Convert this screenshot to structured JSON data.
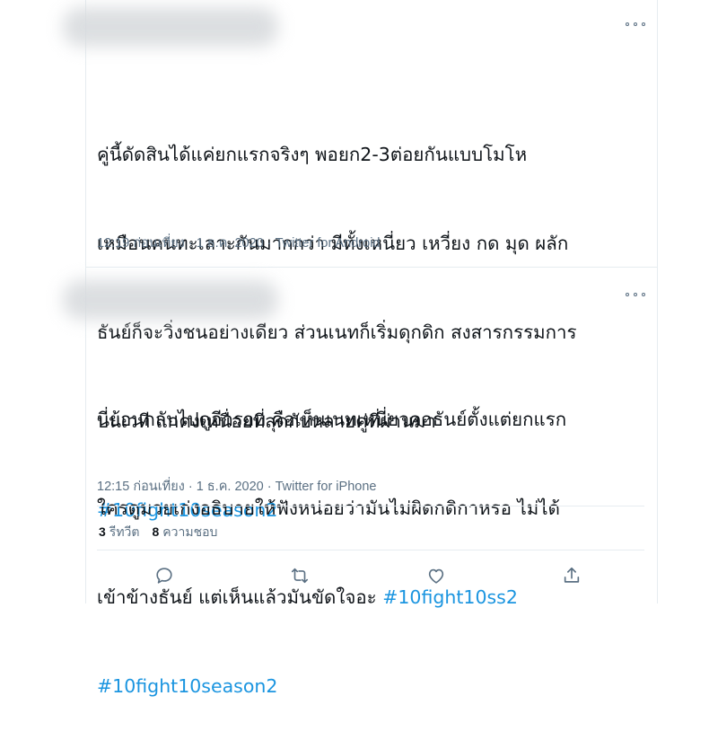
{
  "tweets": [
    {
      "text_lines": [
        "คู่นี้ดัดสินได้แค่ยกแรกจริงๆ พอยก2-3ต่อยกันแบบโมโห",
        "เหมือนคนทะเลาะกันมากกว่า มีทั้งเหนี่ยว เหวี่ยง กด มุด ผลัก",
        "ธันย์ก็จะวิ่งชนอย่างเดียว ส่วนเนทก็เริ่มดุกดิก สงสารกรรมการ",
        "บนเวที แกคงเหนื่อยที่สุดกับหลายคู่ที่ผ่านมา"
      ],
      "hashtags": [
        "#10fight10season2"
      ],
      "time": "12:19 ก่อนเที่ยง",
      "date": "1 ธ.ค. 2020",
      "source": "Twitter for Android"
    },
    {
      "text_lines": [
        "นี่ย้อนกลับไปดูอีกรอบ คือเห็นเนทเหนี่ยวคอธันย์ตั้งแต่ยกแรก",
        "ใครดูมวยเก่งอธิบายให้ฟังหน่อยว่ามันไม่ผิดกดิกาหรอ ไม่ได้",
        "เข้าข้างธันย์ แต่เห็นแล้วมันขัดใจอะ "
      ],
      "inline_hashtag": "#10fight10ss2",
      "hashtags": [
        "#10fight10season2"
      ],
      "time": "12:15 ก่อนเที่ยง",
      "date": "1 ธ.ค. 2020",
      "source": "Twitter for iPhone"
    }
  ],
  "stats": {
    "retweets_count": "3",
    "retweets_label": "รีทวีต",
    "likes_count": "8",
    "likes_label": "ความชอบ"
  },
  "separator": "·",
  "colors": {
    "hashtag": "#1b95e0",
    "meta": "#5b7083",
    "text": "#0f1419"
  },
  "icons": [
    "more-icon",
    "reply-icon",
    "retweet-icon",
    "like-icon",
    "share-icon"
  ]
}
